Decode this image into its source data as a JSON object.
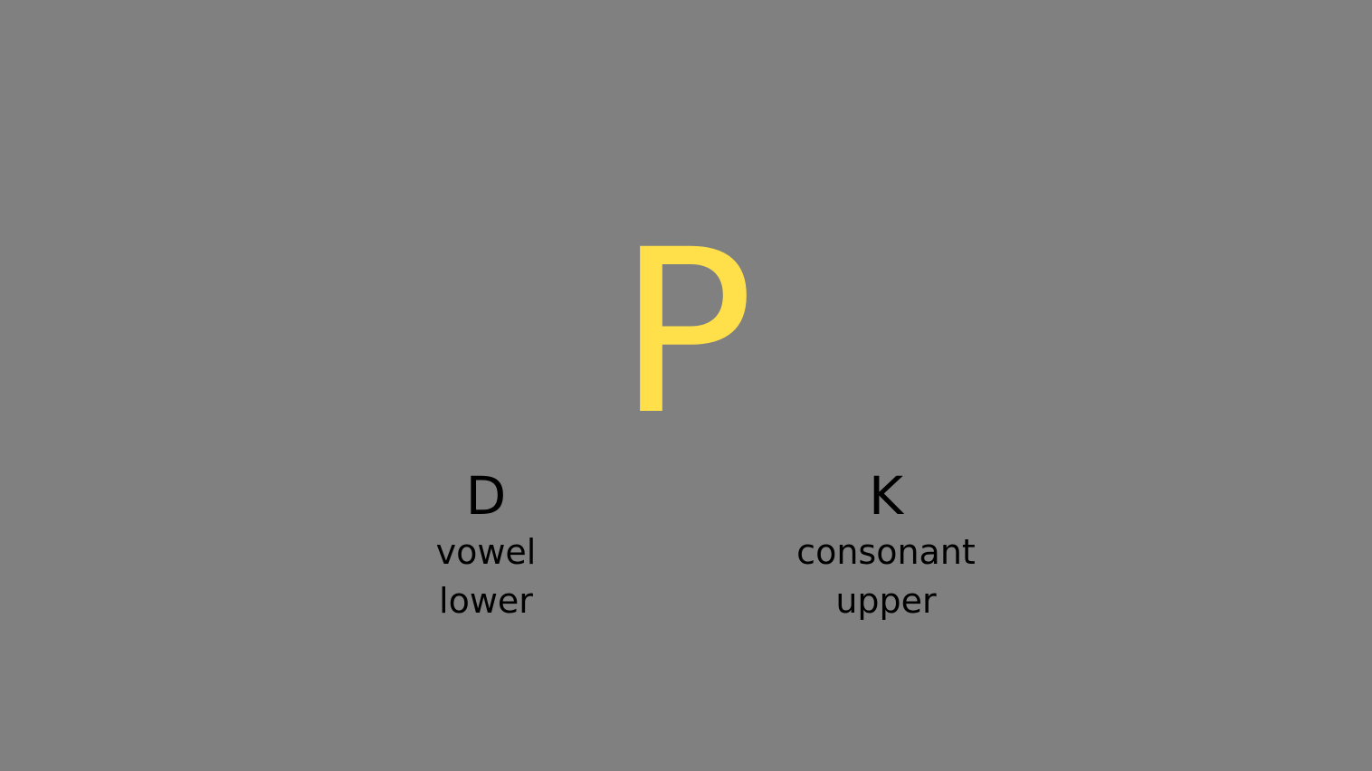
{
  "stimulus": {
    "letter": "P",
    "color": "#ffe04a"
  },
  "background_color": "#808080",
  "options": {
    "left": {
      "key": "D",
      "line1": "vowel",
      "line2": "lower"
    },
    "right": {
      "key": "K",
      "line1": "consonant",
      "line2": "upper"
    }
  }
}
